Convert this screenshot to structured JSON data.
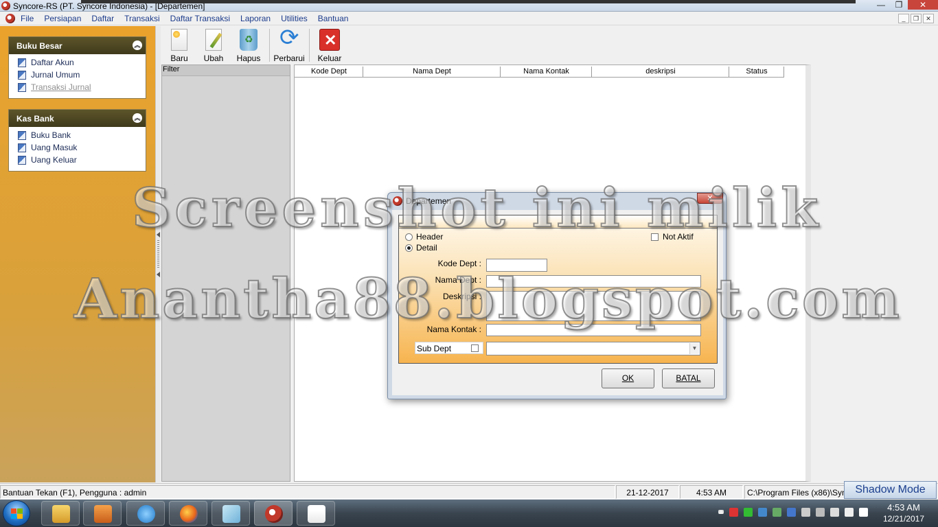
{
  "window": {
    "title": "Syncore-RS (PT. Syncore Indonesia)  - [Departemen]",
    "controls": [
      "—",
      "❐",
      "✕"
    ]
  },
  "menu": {
    "items": [
      "File",
      "Persiapan",
      "Daftar",
      "Transaksi",
      "Daftar Transaksi",
      "Laporan",
      "Utilities",
      "Bantuan"
    ],
    "mdi_controls": [
      "_",
      "❐",
      "✕"
    ]
  },
  "sidebar": {
    "panels": [
      {
        "title": "Buku Besar",
        "items": [
          "Daftar Akun",
          "Jurnal Umum",
          "Transaksi Jurnal"
        ]
      },
      {
        "title": "Kas Bank",
        "items": [
          "Buku Bank",
          "Uang Masuk",
          "Uang Keluar"
        ]
      }
    ]
  },
  "toolbar": {
    "buttons": [
      "Baru",
      "Ubah",
      "Hapus",
      "Perbarui",
      "Keluar"
    ]
  },
  "filter": {
    "label": "Filter"
  },
  "grid": {
    "columns": [
      "Kode Dept",
      "Nama Dept",
      "Nama Kontak",
      "deskripsi",
      "Status"
    ]
  },
  "dialog": {
    "title": "Departemen",
    "radio_header": "Header",
    "radio_detail": "Detail",
    "selected_radio": "Detail",
    "not_aktif_label": "Not Aktif",
    "fields": {
      "kode_dept": "Kode Dept :",
      "nama_dept": "Nama Dept :",
      "deskripsi": "Deskripsi :",
      "nama_kontak": "Nama Kontak :"
    },
    "sub_dept_label": "Sub Dept",
    "ok_label": "OK",
    "batal_label": "BATAL"
  },
  "watermark": {
    "line1": "Screenshot ini milik",
    "line2": "Anantha88.blogspot.com"
  },
  "statusbar": {
    "help": "Bantuan Tekan (F1), Pengguna : admin",
    "date": "21-12-2017",
    "time": "4:53 AM",
    "path": "C:\\Program Files (x86)\\Syncore",
    "shadow_mode": "Shadow Mode"
  },
  "taskbar": {
    "clock_time": "4:53 AM",
    "clock_date": "12/21/2017"
  },
  "colors": {
    "sidebar_top": "#eaa22c",
    "panel_header": "#4e4722",
    "dialog_gradient_end": "#f7b44f",
    "close_button": "#c8453c"
  }
}
